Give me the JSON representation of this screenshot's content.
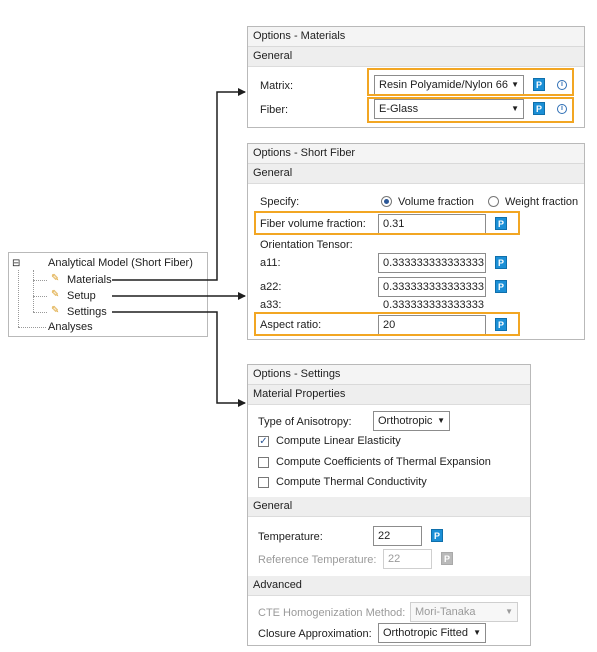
{
  "tree": {
    "root": "Analytical Model (Short Fiber)",
    "expander": "⊟",
    "children": [
      "Materials",
      "Setup",
      "Settings"
    ],
    "analyses": "Analyses"
  },
  "materials": {
    "title": "Options - Materials",
    "section": "General",
    "matrix_label": "Matrix:",
    "matrix_value": "Resin Polyamide/Nylon 66",
    "fiber_label": "Fiber:",
    "fiber_value": "E-Glass",
    "p_label": "P",
    "info_label": "i"
  },
  "short_fiber": {
    "title": "Options - Short Fiber",
    "section": "General",
    "specify_label": "Specify:",
    "volume_fraction": "Volume fraction",
    "weight_fraction": "Weight fraction",
    "fvf_label": "Fiber volume fraction:",
    "fvf_value": "0.31",
    "orientation_label": "Orientation Tensor:",
    "a11_label": "a11:",
    "a11_value": "0.333333333333333",
    "a22_label": "a22:",
    "a22_value": "0.333333333333333",
    "a33_label": "a33:",
    "a33_value": "0.333333333333333",
    "aspect_label": "Aspect ratio:",
    "aspect_value": "20",
    "p_label": "P"
  },
  "settings": {
    "title": "Options - Settings",
    "material_properties": "Material Properties",
    "anisotropy_label": "Type of Anisotropy:",
    "anisotropy_value": "Orthotropic",
    "check_elasticity": "Compute Linear Elasticity",
    "check_cte": "Compute Coefficients of Thermal Expansion",
    "check_conductivity": "Compute Thermal Conductivity",
    "general": "General",
    "temperature_label": "Temperature:",
    "temperature_value": "22",
    "ref_temperature_label": "Reference Temperature:",
    "ref_temperature_value": "22",
    "advanced": "Advanced",
    "cte_method_label": "CTE Homogenization Method:",
    "cte_method_value": "Mori-Tanaka",
    "closure_label": "Closure Approximation:",
    "closure_value": "Orthotropic Fitted",
    "p_label": "P",
    "checked_states": [
      true,
      false,
      false
    ]
  },
  "colors": {
    "highlight": "#f2a623",
    "param_button": "#1b8fd6"
  }
}
